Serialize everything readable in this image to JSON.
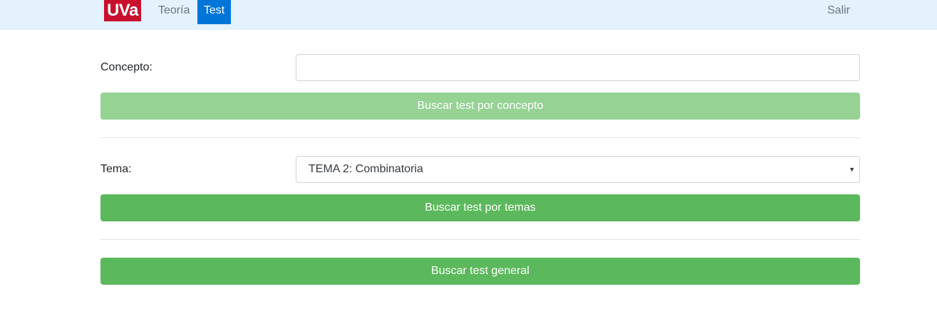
{
  "navbar": {
    "logo_text": "UVa",
    "links": [
      {
        "label": "Teoría",
        "active": false
      },
      {
        "label": "Test",
        "active": true
      }
    ],
    "logout_label": "Salir"
  },
  "concept_form": {
    "label": "Concepto:",
    "input_value": "",
    "input_placeholder": "",
    "button_label": "Buscar test por concepto",
    "button_disabled": true
  },
  "topic_form": {
    "label": "Tema:",
    "selected_option": "TEMA 2: Combinatoria",
    "button_label": "Buscar test por temas"
  },
  "general_form": {
    "button_label": "Buscar test general"
  },
  "colors": {
    "navbar_bg": "#e3f2fd",
    "logo_bg": "#c8102e",
    "active_tab_bg": "#0275d8",
    "button_green": "#5cb85c",
    "button_green_disabled": "#96d294"
  }
}
